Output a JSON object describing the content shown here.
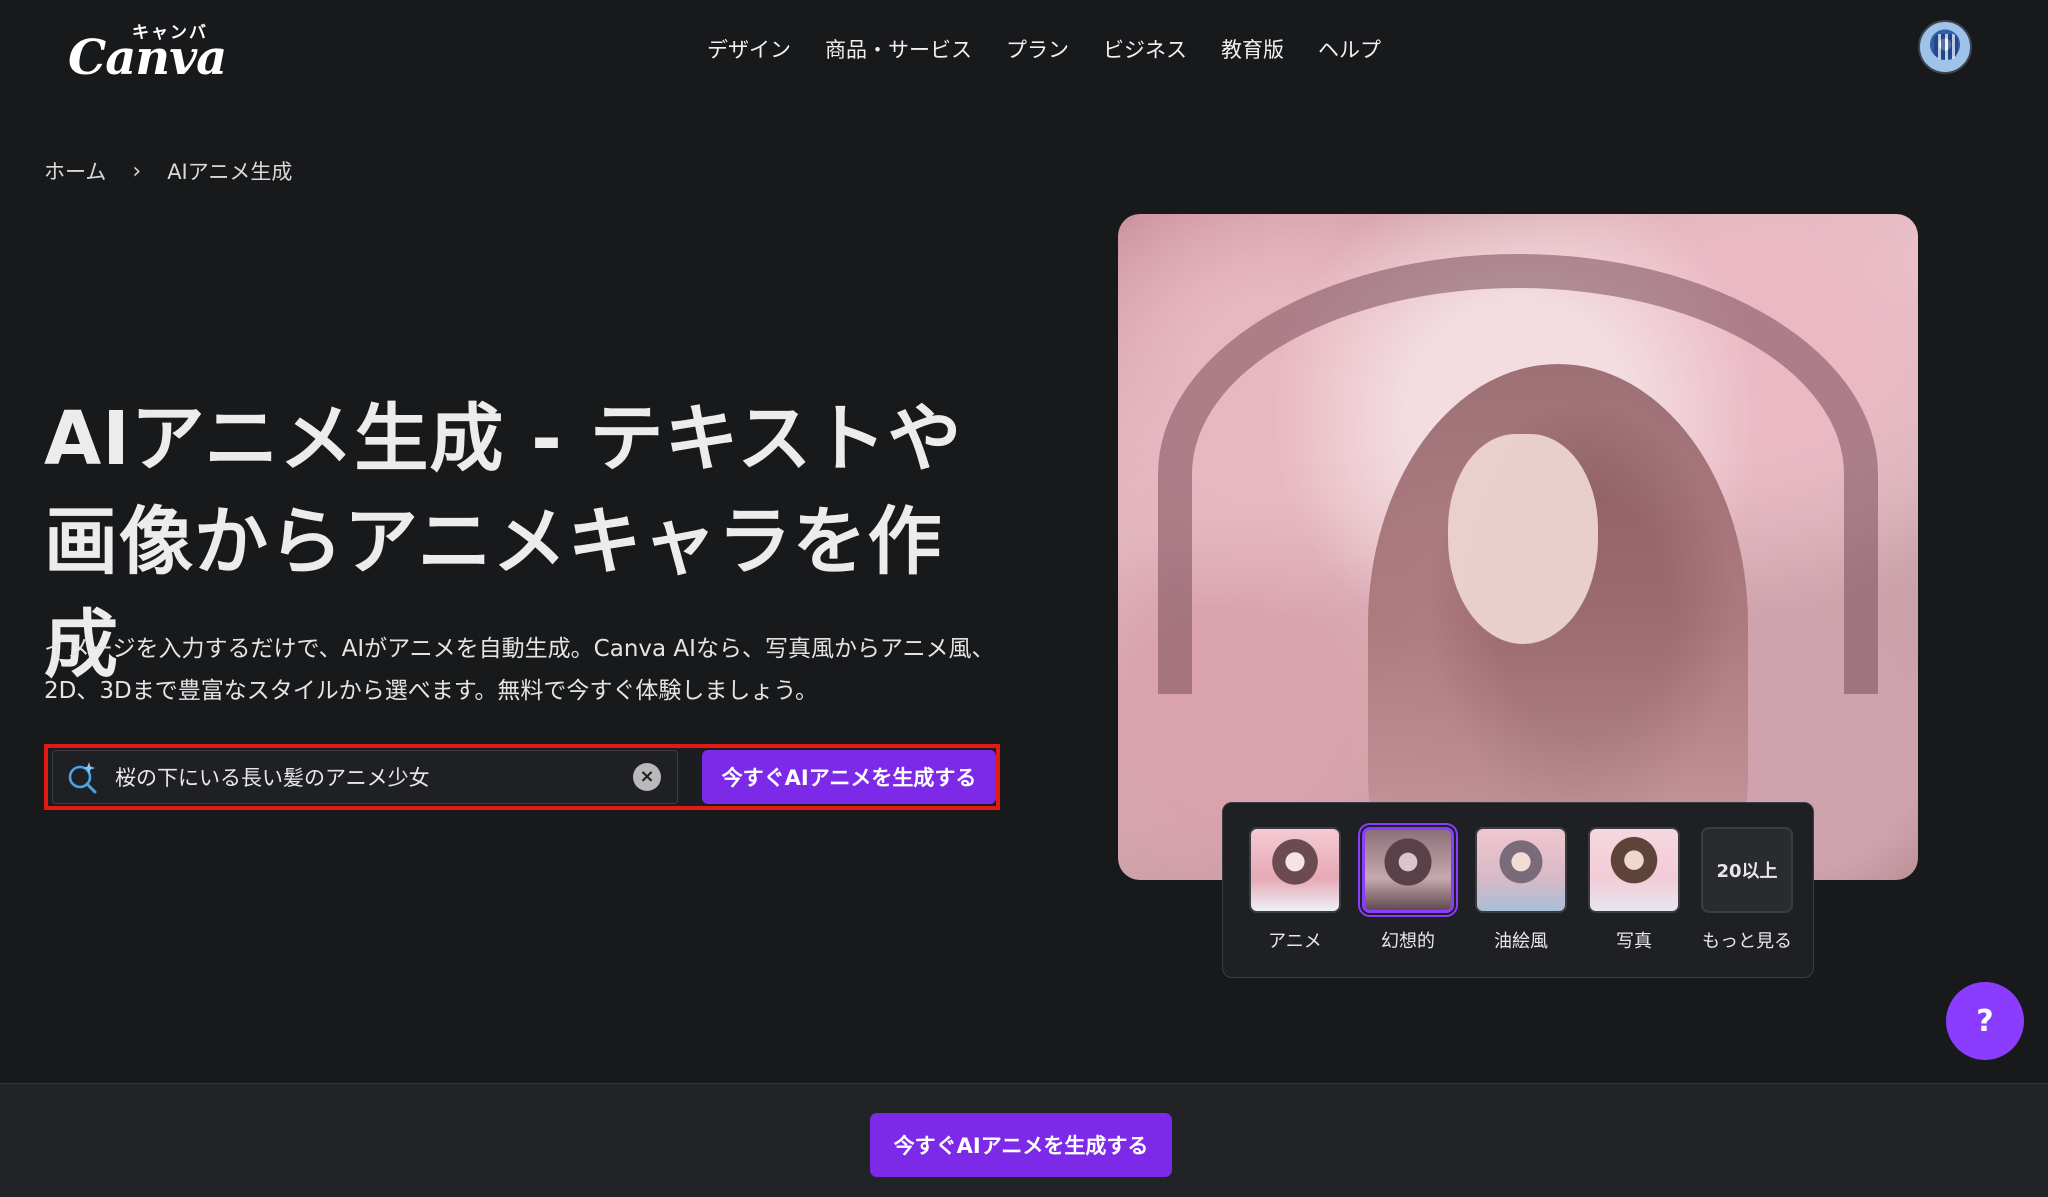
{
  "header": {
    "logo_word": "Canva",
    "logo_kana": "キャンバ",
    "nav": [
      {
        "label": "デザイン"
      },
      {
        "label": "商品・サービス"
      },
      {
        "label": "プラン"
      },
      {
        "label": "ビジネス"
      },
      {
        "label": "教育版"
      },
      {
        "label": "ヘルプ"
      }
    ]
  },
  "breadcrumb": {
    "home": "ホーム",
    "separator": "›",
    "current": "AIアニメ生成"
  },
  "hero": {
    "title": "AIアニメ生成 - テキストや画像からアニメキャラを作成",
    "description": "イメージを入力するだけで、AIがアニメを自動生成。Canva AIなら、写真風からアニメ風、2D、3Dまで豊富なスタイルから選べます。無料で今すぐ体験しましょう。"
  },
  "search": {
    "value": "桜の下にいる長い髪のアニメ少女",
    "clear_glyph": "×",
    "button_label": "今すぐAIアニメを生成する"
  },
  "styles": {
    "selected": "幻想的",
    "options": [
      {
        "label": "アニメ"
      },
      {
        "label": "幻想的"
      },
      {
        "label": "油絵風"
      },
      {
        "label": "写真"
      }
    ],
    "more_thumb": "20以上",
    "more_label": "もっと見る"
  },
  "help": {
    "glyph": "?"
  },
  "bottom_bar": {
    "cta_label": "今すぐAIアニメを生成する"
  },
  "colors": {
    "background": "#18191b",
    "accent": "#7d2ae8",
    "highlight_border": "#e21a14"
  }
}
